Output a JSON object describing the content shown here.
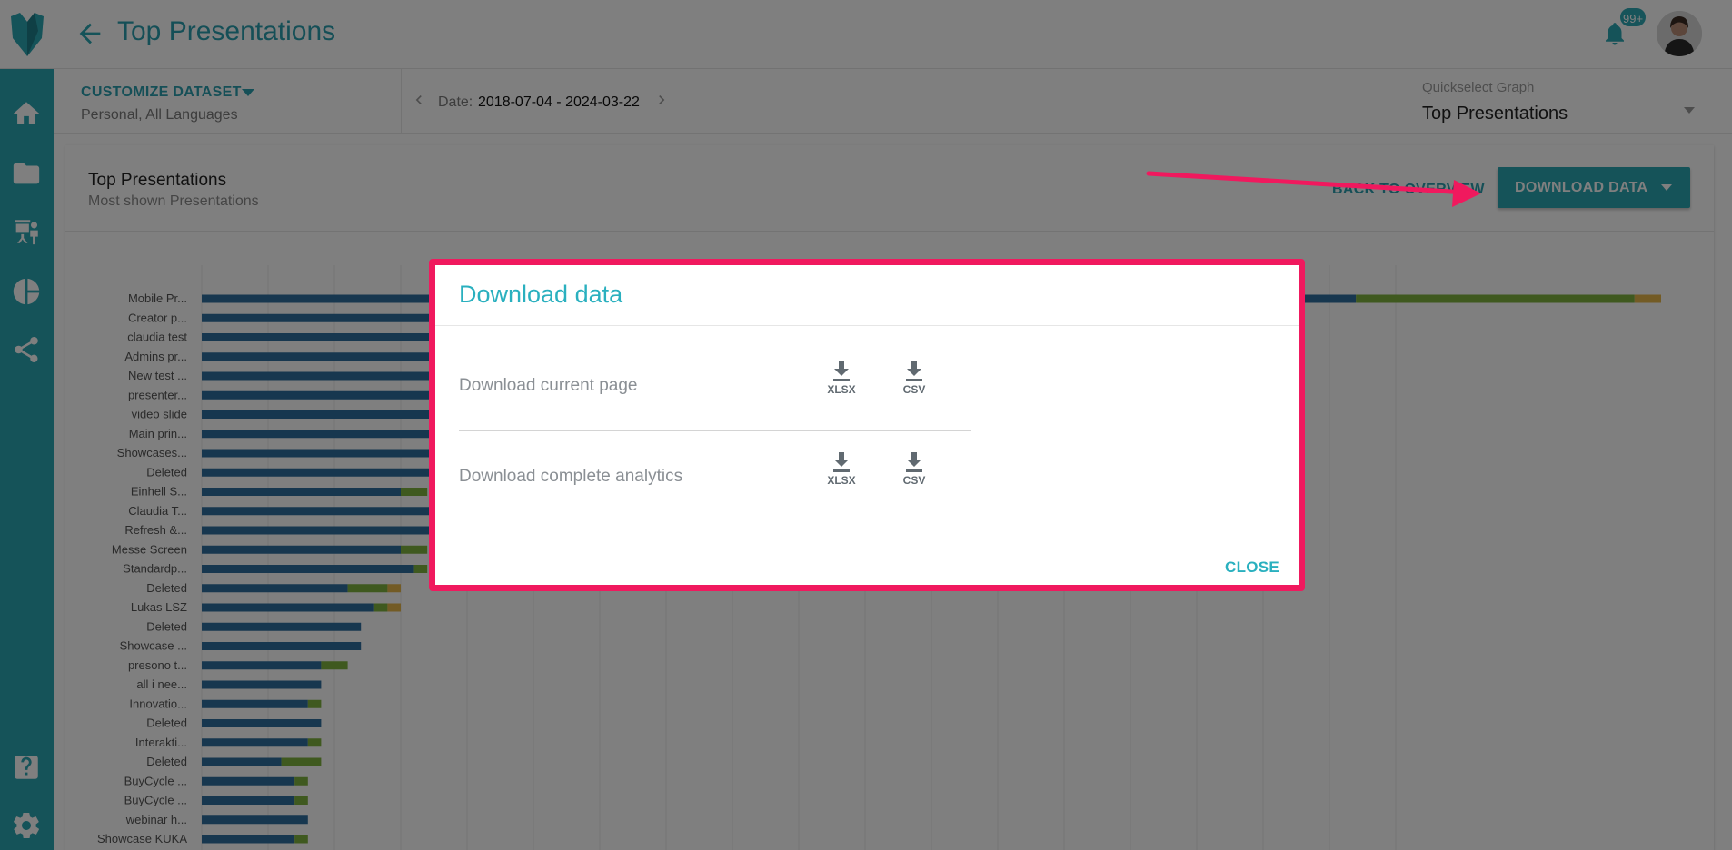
{
  "header": {
    "title": "Top Presentations",
    "notification_count": "99+"
  },
  "filter": {
    "customize_label": "CUSTOMIZE DATASET",
    "dataset": "Personal, All Languages",
    "date_label": "Date:",
    "date_value": "2018-07-04 - 2024-03-22",
    "quickselect_label": "Quickselect Graph",
    "quickselect_value": "Top Presentations"
  },
  "card": {
    "title": "Top Presentations",
    "subtitle": "Most shown Presentations",
    "back_view_label": "BACK TO OVERVIEW",
    "download_button_label": "DOWNLOAD DATA"
  },
  "modal": {
    "title": "Download data",
    "row1_label": "Download current page",
    "row2_label": "Download complete analytics",
    "xlsx_label": "XLSX",
    "csv_label": "CSV",
    "close_label": "CLOSE"
  },
  "colors": {
    "teal": "#2aa6b3",
    "bar_blue": "#2f6f9e",
    "bar_green": "#7fb23f",
    "bar_yellow": "#e6b74a",
    "highlight": "#f0195e"
  },
  "chart_data": {
    "type": "bar",
    "stacked": true,
    "orientation": "horizontal",
    "categories": [
      "Mobile Pr...",
      "Creator p...",
      "claudia test",
      "Admins pr...",
      "New test ...",
      "presenter...",
      "video slide",
      "Main prin...",
      "Showcases...",
      "Deleted",
      "Einhell S...",
      "Claudia T...",
      "Refresh &...",
      "Messe Screen",
      "Standardp...",
      "Deleted",
      "Lukas LSZ",
      "Deleted",
      "Showcase ...",
      "presono t...",
      "all i nee...",
      "Innovatio...",
      "Deleted",
      "Interakti...",
      "Deleted",
      "BuyCycle ...",
      "BuyCycle ...",
      "webinar h...",
      "Showcase KUKA"
    ],
    "series": [
      {
        "values": [
          87,
          20,
          20,
          20,
          20,
          20,
          20,
          20,
          20,
          20,
          15,
          20,
          20,
          15,
          16,
          11,
          13,
          12,
          12,
          9,
          9,
          8,
          9,
          8,
          6,
          7,
          7,
          8,
          7
        ]
      },
      {
        "values": [
          21,
          0,
          0,
          0,
          0,
          0,
          0,
          0,
          0,
          0,
          2,
          0,
          0,
          2,
          1,
          3,
          1,
          0,
          0,
          2,
          0,
          1,
          0,
          1,
          3,
          1,
          1,
          0,
          1
        ]
      },
      {
        "values": [
          2,
          0,
          0,
          0,
          0,
          0,
          0,
          0,
          0,
          0,
          0,
          0,
          0,
          0,
          0,
          1,
          1,
          0,
          0,
          0,
          0,
          0,
          0,
          0,
          0,
          0,
          0,
          0,
          0
        ]
      }
    ],
    "grid": true
  }
}
